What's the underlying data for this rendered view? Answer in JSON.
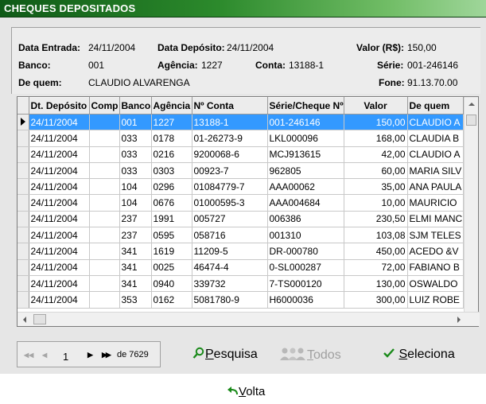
{
  "window": {
    "title": "CHEQUES DEPOSITADOS"
  },
  "header": {
    "data_entrada_label": "Data Entrada:",
    "data_entrada": "24/11/2004",
    "data_deposito_label": "Data Depósito:",
    "data_deposito": "24/11/2004",
    "valor_label": "Valor (R$):",
    "valor": "150,00",
    "banco_label": "Banco:",
    "banco": "001",
    "agencia_label": "Agência:",
    "agencia": "1227",
    "conta_label": "Conta:",
    "conta": "13188-1",
    "serie_label": "Série:",
    "serie": "001-246146",
    "de_quem_label": "De quem:",
    "de_quem": "CLAUDIO ALVARENGA",
    "fone_label": "Fone:",
    "fone": "91.13.70.00"
  },
  "grid": {
    "columns": [
      "Dt. Depósito",
      "Comp",
      "Banco",
      "Agência",
      "Nº Conta",
      "Série/Cheque Nº",
      "Valor",
      "De quem"
    ],
    "selected_row": 0,
    "rows": [
      [
        "24/11/2004",
        "",
        "001",
        "1227",
        "13188-1",
        "001-246146",
        "150,00",
        "CLAUDIO A"
      ],
      [
        "24/11/2004",
        "",
        "033",
        "0178",
        "01-26273-9",
        "LKL000096",
        "168,00",
        "CLAUDIA B"
      ],
      [
        "24/11/2004",
        "",
        "033",
        "0216",
        "9200068-6",
        "MCJ913615",
        "42,00",
        "CLAUDIO A"
      ],
      [
        "24/11/2004",
        "",
        "033",
        "0303",
        "00923-7",
        "962805",
        "60,00",
        "MARIA SILV"
      ],
      [
        "24/11/2004",
        "",
        "104",
        "0296",
        "01084779-7",
        "AAA00062",
        "35,00",
        "ANA PAULA"
      ],
      [
        "24/11/2004",
        "",
        "104",
        "0676",
        "01000595-3",
        "AAA004684",
        "10,00",
        "MAURICIO"
      ],
      [
        "24/11/2004",
        "",
        "237",
        "1991",
        "005727",
        "006386",
        "230,50",
        "ELMI MANC"
      ],
      [
        "24/11/2004",
        "",
        "237",
        "0595",
        "058716",
        "001310",
        "103,08",
        "SJM TELES"
      ],
      [
        "24/11/2004",
        "",
        "341",
        "1619",
        "11209-5",
        "DR-000780",
        "450,00",
        "ACEDO &V"
      ],
      [
        "24/11/2004",
        "",
        "341",
        "0025",
        "46474-4",
        "0-SL000287",
        "72,00",
        "FABIANO B"
      ],
      [
        "24/11/2004",
        "",
        "341",
        "0940",
        "339732",
        "7-TS000120",
        "130,00",
        "OSWALDO"
      ],
      [
        "24/11/2004",
        "",
        "353",
        "0162",
        "5081780-9",
        "H6000036",
        "300,00",
        "LUIZ ROBE"
      ]
    ]
  },
  "navigator": {
    "first": "◀◀",
    "prev": "◀",
    "page": "1",
    "next": "▶",
    "last": "▶▶",
    "total": "de 7629"
  },
  "actions": {
    "pesquisa": {
      "accel": "P",
      "rest": "esquisa"
    },
    "todos": {
      "accel": "T",
      "rest": "odos"
    },
    "seleciona": {
      "accel": "S",
      "rest": "eleciona"
    },
    "volta": {
      "accel": "V",
      "rest": "olta"
    }
  },
  "colors": {
    "title_dark": "#0f5a17",
    "title_light": "#9fd69a",
    "selection": "#3399ff",
    "icon_green": "#1a8a1a"
  }
}
